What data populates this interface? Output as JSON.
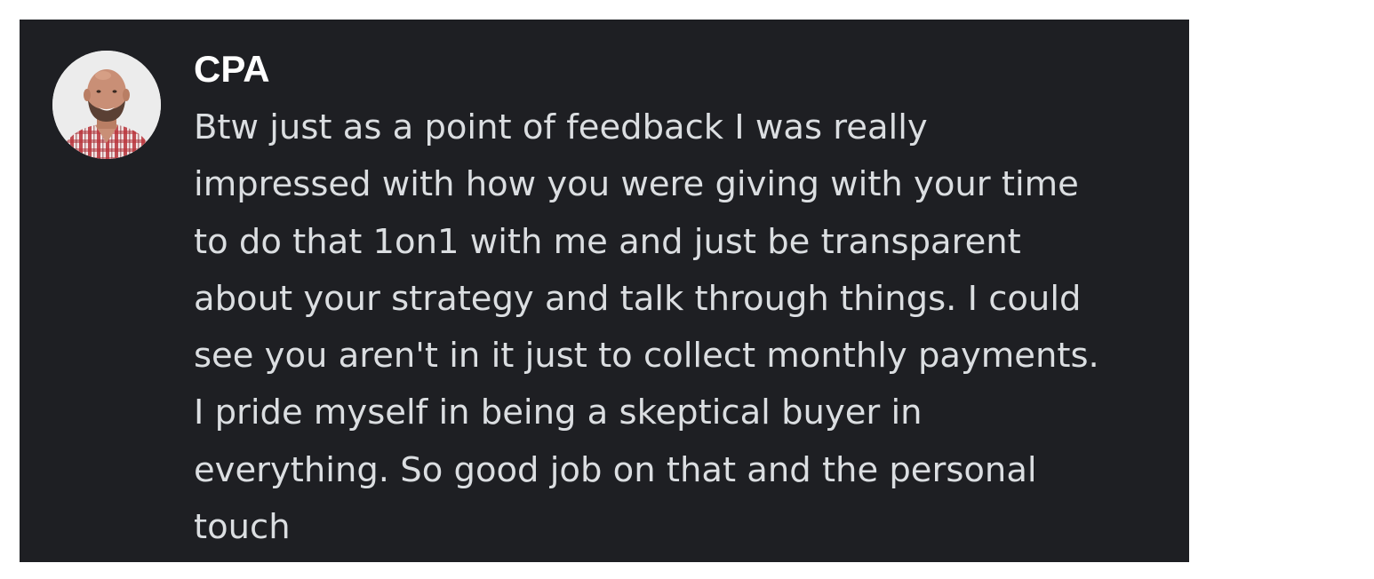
{
  "message": {
    "author": "CPA",
    "avatar_icon": "user-avatar-photo",
    "text_lines": [
      "Btw just as a point of feedback I was really",
      "impressed with how you were giving with your time",
      "to do that 1on1 with me and just be transparent",
      "about your strategy and talk through things. I could",
      "see you aren't in it just to collect monthly payments.",
      "I pride myself in being a skeptical buyer in",
      "everything. So good job on that and the personal",
      "touch"
    ]
  },
  "colors": {
    "panel_background": "#1e1f23",
    "author_text": "#ffffff",
    "message_text": "#dbdee1",
    "page_background": "#ffffff"
  }
}
